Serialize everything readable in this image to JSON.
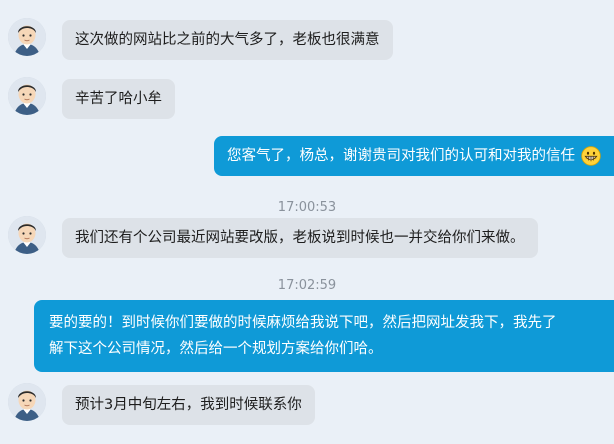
{
  "messages": [
    {
      "side": "left",
      "text": "这次做的网站比之前的大气多了，老板也很满意"
    },
    {
      "side": "left",
      "text": "辛苦了哈小牟"
    },
    {
      "side": "right",
      "text": "您客气了，杨总，谢谢贵司对我们的认可和对我的信任",
      "emoji": "grinning-face-icon"
    },
    {
      "type": "timestamp",
      "text": "17:00:53"
    },
    {
      "side": "left",
      "text": "我们还有个公司最近网站要改版，老板说到时候也一并交给你们来做。"
    },
    {
      "type": "timestamp",
      "text": "17:02:59"
    },
    {
      "side": "right",
      "lines": [
        "要的要的！到时候你们要做的时候麻烦给我说下吧，然后把网址发我下，我先了",
        "解下这个公司情况，然后给一个规划方案给你们哈。"
      ]
    },
    {
      "side": "left",
      "text": "预计3月中旬左右，我到时候联系你"
    }
  ],
  "colors": {
    "background": "#eaf0f7",
    "incoming_bubble": "#dde2e8",
    "outgoing_bubble": "#0f9ad7",
    "timestamp_text": "#8a929c"
  }
}
